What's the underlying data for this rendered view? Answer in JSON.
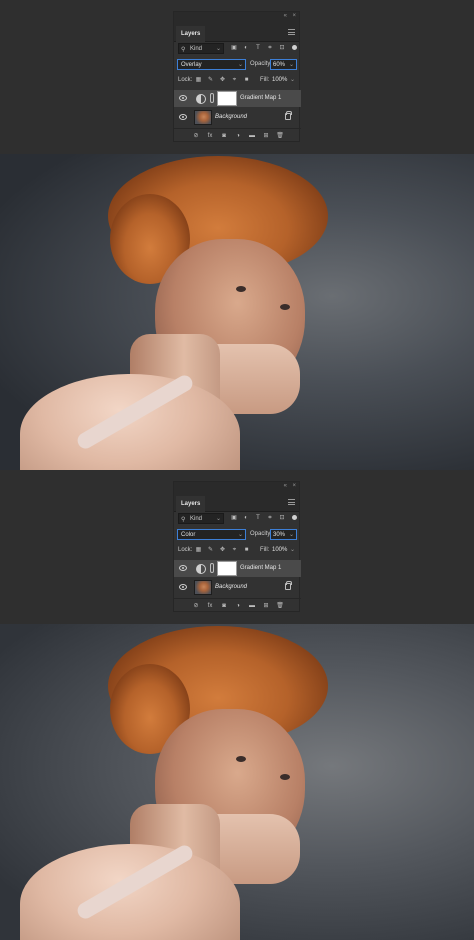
{
  "panels": [
    {
      "tab_label": "Layers",
      "kind_label": "Kind",
      "blend_mode": "Overlay",
      "opacity_label": "Opacity:",
      "opacity_value": "60%",
      "lock_label": "Lock:",
      "fill_label": "Fill:",
      "fill_value": "100%",
      "layers": [
        {
          "name": "Gradient Map 1",
          "type": "adjustment",
          "selected": true
        },
        {
          "name": "Background",
          "type": "image",
          "locked": true
        }
      ]
    },
    {
      "tab_label": "Layers",
      "kind_label": "Kind",
      "blend_mode": "Color",
      "opacity_label": "Opacity:",
      "opacity_value": "30%",
      "lock_label": "Lock:",
      "fill_label": "Fill:",
      "fill_value": "100%",
      "layers": [
        {
          "name": "Gradient Map 1",
          "type": "adjustment",
          "selected": true
        },
        {
          "name": "Background",
          "type": "image",
          "locked": true
        }
      ]
    }
  ],
  "icons": {
    "filters": [
      "image-filter-icon",
      "adjustment-filter-icon",
      "type-filter-icon",
      "shape-filter-icon",
      "smart-object-filter-icon"
    ],
    "locks": [
      "lock-transparent-pixels-icon",
      "lock-image-pixels-icon",
      "lock-position-icon",
      "lock-artboard-icon",
      "lock-all-icon"
    ],
    "footer": [
      "link-layers-icon",
      "fx-icon",
      "add-mask-icon",
      "new-adjustment-icon",
      "new-group-icon",
      "new-layer-icon",
      "delete-icon"
    ]
  },
  "colors": {
    "panel_bg": "#323232",
    "highlight_border": "#3d7fd6",
    "selected_layer": "#4a4a4a"
  }
}
